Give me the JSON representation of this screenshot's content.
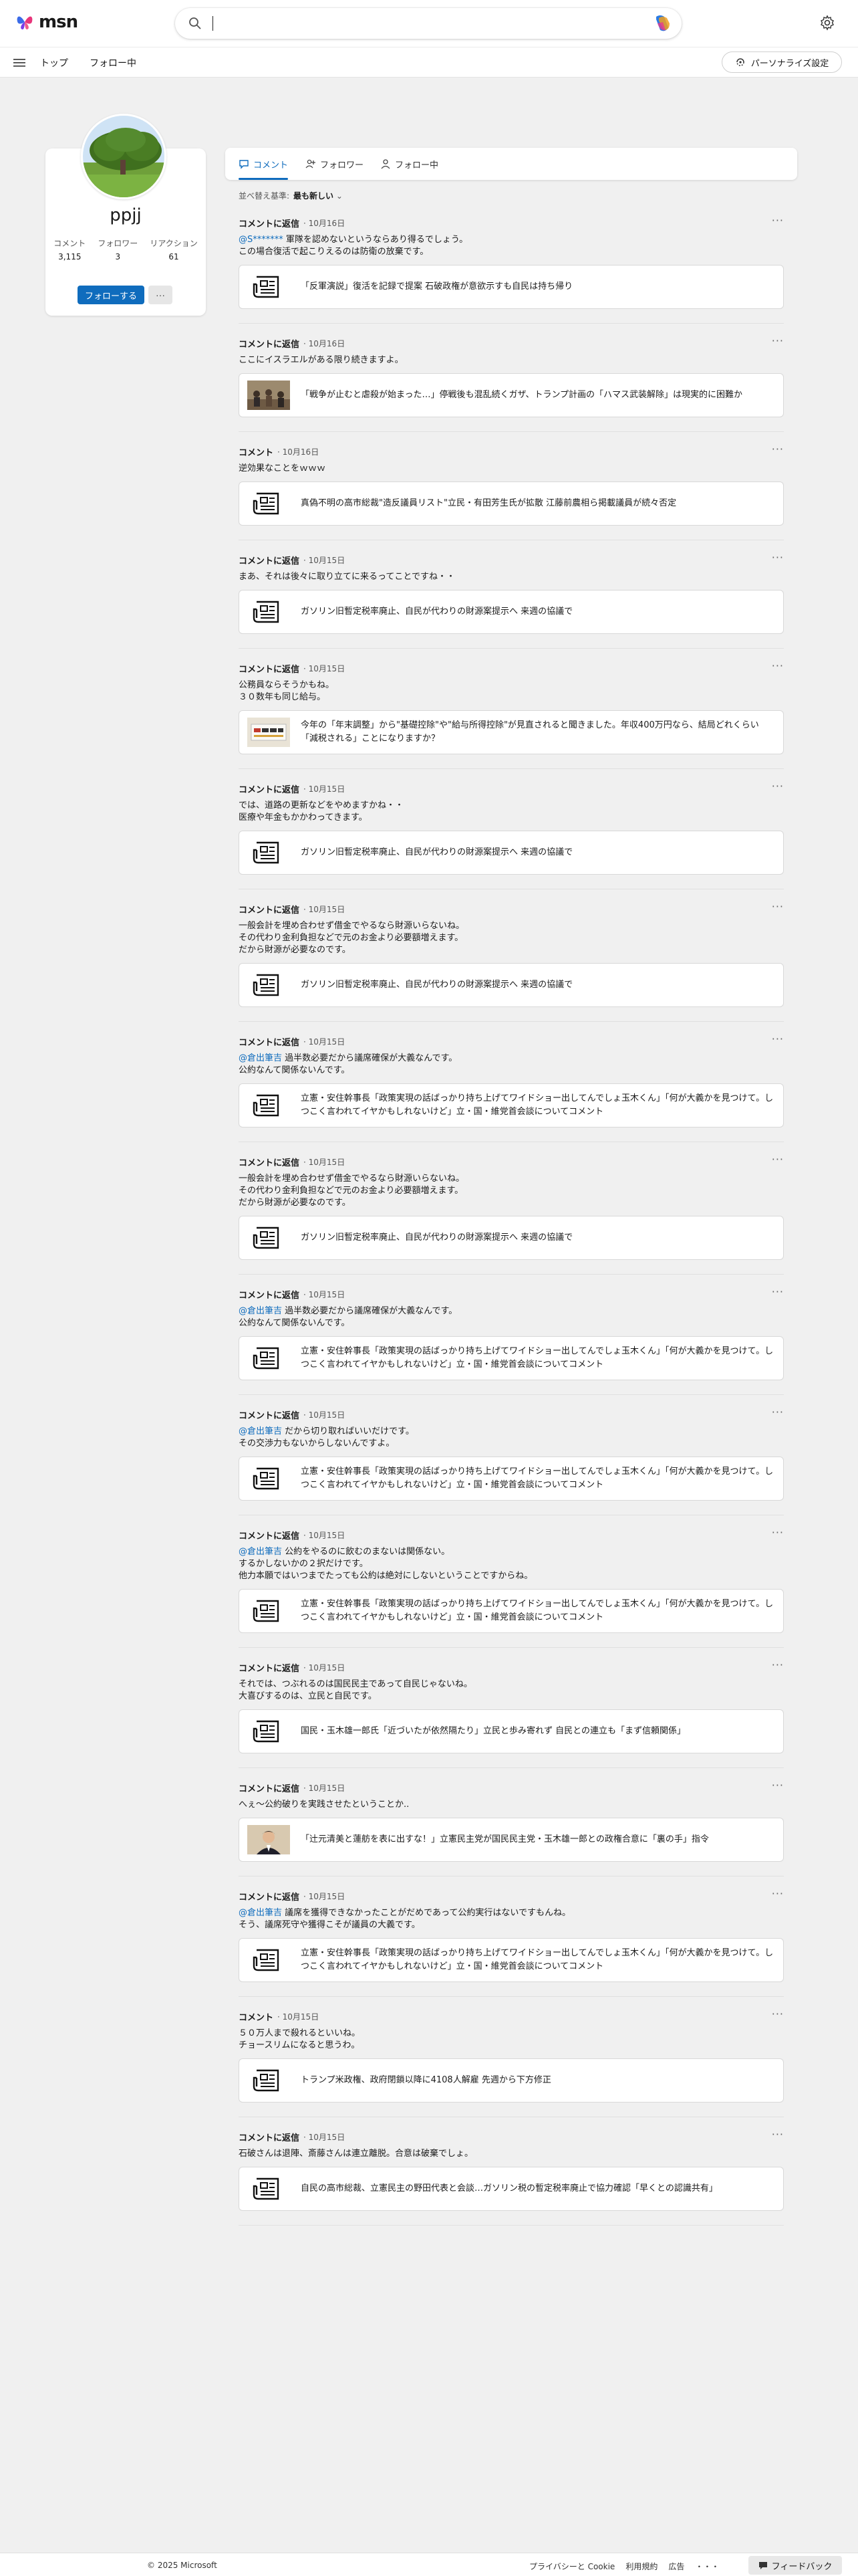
{
  "header": {
    "logo_text": "msn",
    "search_value": ""
  },
  "subnav": {
    "items": [
      "トップ",
      "フォロー中"
    ],
    "personalize": "パーソナライズ設定"
  },
  "profile": {
    "name": "ppjj",
    "stats": [
      {
        "label": "コメント",
        "value": "3,115"
      },
      {
        "label": "フォロワー",
        "value": "3"
      },
      {
        "label": "リアクション",
        "value": "61"
      }
    ],
    "follow": "フォローする",
    "more": "···"
  },
  "tabs": [
    "コメント",
    "フォロワー",
    "フォロー中"
  ],
  "sort": {
    "label": "並べ替え基準:",
    "value": "最も新しい"
  },
  "comments": [
    {
      "title": "コメントに返信",
      "date": "10月16日",
      "mention": "@S*******",
      "lines": [
        "軍隊を認めないというならあり得るでしょう。",
        "この場合復活で起こりえるのは防衛の放棄です。"
      ],
      "card": "「反軍演説」復活を記録で提案 石破政権が意欲示すも自民は持ち帰り",
      "thumb": "news"
    },
    {
      "title": "コメントに返信",
      "date": "10月16日",
      "mention": "",
      "lines": [
        "ここにイスラエルがある限り続きますよ。"
      ],
      "card": "「戦争が止むと虐殺が始まった…」停戦後も混乱続くガザ、トランプ計画の「ハマス武装解除」は現実的に困難か",
      "thumb": "photo-gaza"
    },
    {
      "title": "コメント",
      "date": "10月16日",
      "mention": "",
      "lines": [
        "逆効果なことをｗｗｗ"
      ],
      "card": "真偽不明の高市総裁\"造反議員リスト\"立民・有田芳生氏が拡散 江藤前農相ら掲載議員が続々否定",
      "thumb": "news"
    },
    {
      "title": "コメントに返信",
      "date": "10月15日",
      "mention": "",
      "lines": [
        "まあ、それは後々に取り立てに来るってことですね・・"
      ],
      "card": "ガソリン旧暫定税率廃止、自民が代わりの財源案提示へ 来週の協議で",
      "thumb": "news"
    },
    {
      "title": "コメントに返信",
      "date": "10月15日",
      "mention": "",
      "lines": [
        "公務員ならそうかもね。",
        "３０数年も同じ給与。"
      ],
      "card": "今年の「年末調整」から\"基礎控除\"や\"給与所得控除\"が見直されると聞きました。年収400万円なら、結局どれくらい「減税される」ことになりますか？",
      "thumb": "photo-docs"
    },
    {
      "title": "コメントに返信",
      "date": "10月15日",
      "mention": "",
      "lines": [
        "では、道路の更新などをやめますかね・・",
        "医療や年金もかかわってきます。"
      ],
      "card": "ガソリン旧暫定税率廃止、自民が代わりの財源案提示へ 来週の協議で",
      "thumb": "news"
    },
    {
      "title": "コメントに返信",
      "date": "10月15日",
      "mention": "",
      "lines": [
        "一般会計を埋め合わせず借金でやるなら財源いらないね。",
        "その代わり金利負担などで元のお金より必要額増えます。",
        "だから財源が必要なのです。"
      ],
      "card": "ガソリン旧暫定税率廃止、自民が代わりの財源案提示へ 来週の協議で",
      "thumb": "news"
    },
    {
      "title": "コメントに返信",
      "date": "10月15日",
      "mention": "@倉出筆吉",
      "lines": [
        "過半数必要だから議席確保が大義なんです。",
        "公約なんて関係ないんです。"
      ],
      "card": "立憲・安住幹事長「政策実現の話ばっかり持ち上げてワイドショー出してんでしょ玉木くん」「何が大義かを見つけて。しつこく言われてイヤかもしれないけど」立・国・維党首会談についてコメント",
      "thumb": "news"
    },
    {
      "title": "コメントに返信",
      "date": "10月15日",
      "mention": "",
      "lines": [
        "一般会計を埋め合わせず借金でやるなら財源いらないね。",
        "その代わり金利負担などで元のお金より必要額増えます。",
        "だから財源が必要なのです。"
      ],
      "card": "ガソリン旧暫定税率廃止、自民が代わりの財源案提示へ 来週の協議で",
      "thumb": "news"
    },
    {
      "title": "コメントに返信",
      "date": "10月15日",
      "mention": "@倉出筆吉",
      "lines": [
        "過半数必要だから議席確保が大義なんです。",
        "公約なんて関係ないんです。"
      ],
      "card": "立憲・安住幹事長「政策実現の話ばっかり持ち上げてワイドショー出してんでしょ玉木くん」「何が大義かを見つけて。しつこく言われてイヤかもしれないけど」立・国・維党首会談についてコメント",
      "thumb": "news"
    },
    {
      "title": "コメントに返信",
      "date": "10月15日",
      "mention": "@倉出筆吉",
      "lines": [
        "だから切り取ればいいだけです。",
        "その交渉力もないからしないんですよ。"
      ],
      "card": "立憲・安住幹事長「政策実現の話ばっかり持ち上げてワイドショー出してんでしょ玉木くん」「何が大義かを見つけて。しつこく言われてイヤかもしれないけど」立・国・維党首会談についてコメント",
      "thumb": "news"
    },
    {
      "title": "コメントに返信",
      "date": "10月15日",
      "mention": "@倉出筆吉",
      "lines": [
        "公約をやるのに飲むのまないは関係ない。",
        "するかしないかの２択だけです。",
        "他力本願ではいつまでたっても公約は絶対にしないということですからね。"
      ],
      "card": "立憲・安住幹事長「政策実現の話ばっかり持ち上げてワイドショー出してんでしょ玉木くん」「何が大義かを見つけて。しつこく言われてイヤかもしれないけど」立・国・維党首会談についてコメント",
      "thumb": "news"
    },
    {
      "title": "コメントに返信",
      "date": "10月15日",
      "mention": "",
      "lines": [
        "それでは、つぶれるのは国民民主であって自民じゃないね。",
        "大喜びするのは、立民と自民です。"
      ],
      "card": "国民・玉木雄一郎氏「近づいたが依然隔たり」立民と歩み寄れず 自民との連立も「まず信頼関係」",
      "thumb": "news"
    },
    {
      "title": "コメントに返信",
      "date": "10月15日",
      "mention": "",
      "lines": [
        "へぇ～公約破りを実践させたということか.."
      ],
      "card": "「辻元清美と蓮舫を表に出すな！」立憲民主党が国民民主党・玉木雄一郎との政権合意に「裏の手」指令",
      "thumb": "photo-person"
    },
    {
      "title": "コメントに返信",
      "date": "10月15日",
      "mention": "@倉出筆吉",
      "lines": [
        "議席を獲得できなかったことがだめであって公約実行はないですもんね。",
        "そう、議席死守や獲得こそが議員の大義です。"
      ],
      "card": "立憲・安住幹事長「政策実現の話ばっかり持ち上げてワイドショー出してんでしょ玉木くん」「何が大義かを見つけて。しつこく言われてイヤかもしれないけど」立・国・維党首会談についてコメント",
      "thumb": "news"
    },
    {
      "title": "コメント",
      "date": "10月15日",
      "mention": "",
      "lines": [
        "５０万人まで殺れるといいね。",
        "チョースリムになると思うわ。"
      ],
      "card": "トランプ米政権、政府閉鎖以降に4108人解雇 先週から下方修正",
      "thumb": "news"
    },
    {
      "title": "コメントに返信",
      "date": "10月15日",
      "mention": "",
      "lines": [
        "石破さんは退陣、斎藤さんは連立離脱。合意は破棄でしょ。"
      ],
      "card": "自民の高市総裁、立憲民主の野田代表と会談…ガソリン税の暫定税率廃止で協力確認「早くとの認識共有」",
      "thumb": "news"
    }
  ],
  "footer": {
    "copyright": "© 2025 Microsoft",
    "links": [
      "プライバシーと Cookie",
      "利用規約",
      "広告",
      "・・・"
    ],
    "feedback": "フィードバック"
  }
}
